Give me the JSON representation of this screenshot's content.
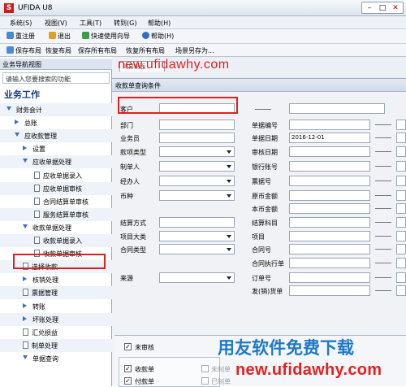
{
  "window": {
    "title": "UFIDA U8",
    "logo": "S"
  },
  "menubar": [
    "系统(S)",
    "视图(V)",
    "工具(T)",
    "转到(G)",
    "帮助(H)"
  ],
  "toolbar1": [
    "重注册",
    "退出",
    "快速使用向导",
    "帮助(H)"
  ],
  "toolbar2": [
    "保存布局",
    "恢复布局",
    "保存所有布局",
    "恢复所有布局",
    "场景另存为..."
  ],
  "sidebar": {
    "header": "业务导航视图",
    "search_placeholder": "请输入您要搜索的功能",
    "title": "业务工作",
    "tree": [
      {
        "label": "财务会计",
        "type": "expanded",
        "level": 0
      },
      {
        "label": "总账",
        "type": "collapsed",
        "level": 1
      },
      {
        "label": "应收款管理",
        "type": "expanded",
        "level": 1
      },
      {
        "label": "设置",
        "type": "collapsed",
        "level": 2
      },
      {
        "label": "应收单据处理",
        "type": "expanded",
        "level": 2
      },
      {
        "label": "应收单据录入",
        "type": "doc",
        "level": 3
      },
      {
        "label": "应收单据审核",
        "type": "doc",
        "level": 3
      },
      {
        "label": "合同结算单审核",
        "type": "doc",
        "level": 3
      },
      {
        "label": "服务结算单审核",
        "type": "doc",
        "level": 3
      },
      {
        "label": "收款单据处理",
        "type": "expanded",
        "level": 2
      },
      {
        "label": "收款单据录入",
        "type": "doc",
        "level": 3
      },
      {
        "label": "收款单据审核",
        "type": "doc",
        "level": 3
      },
      {
        "label": "选择收款",
        "type": "doc",
        "level": 2
      },
      {
        "label": "核销处理",
        "type": "collapsed",
        "level": 2
      },
      {
        "label": "票据管理",
        "type": "doc",
        "level": 2
      },
      {
        "label": "转账",
        "type": "collapsed",
        "level": 2
      },
      {
        "label": "坏账处理",
        "type": "collapsed",
        "level": 2
      },
      {
        "label": "汇兑损益",
        "type": "doc",
        "level": 2
      },
      {
        "label": "制单处理",
        "type": "doc",
        "level": 2
      },
      {
        "label": "单据查询",
        "type": "expanded",
        "level": 2
      }
    ]
  },
  "tabs": {
    "active": "简易桌面"
  },
  "dialog": {
    "title": "收款单查询条件",
    "left_fields": [
      {
        "label": "客户",
        "kind": "input",
        "value": ""
      },
      {
        "label": "部门",
        "kind": "input",
        "value": ""
      },
      {
        "label": "业务员",
        "kind": "input",
        "value": ""
      },
      {
        "label": "款项类型",
        "kind": "select",
        "value": ""
      },
      {
        "label": "制单人",
        "kind": "select",
        "value": ""
      },
      {
        "label": "经办人",
        "kind": "select",
        "value": ""
      },
      {
        "label": "币种",
        "kind": "select",
        "value": ""
      },
      {
        "label": "结算方式",
        "kind": "input",
        "value": ""
      },
      {
        "label": "项目大类",
        "kind": "select",
        "value": ""
      },
      {
        "label": "合同类型",
        "kind": "select",
        "value": ""
      },
      {
        "label": "来源",
        "kind": "select",
        "value": ""
      }
    ],
    "right_fields": [
      {
        "label": "单据编号",
        "kind": "input",
        "value": ""
      },
      {
        "label": "单据日期",
        "kind": "input",
        "value": "2016-12-01"
      },
      {
        "label": "审核日期",
        "kind": "input",
        "value": ""
      },
      {
        "label": "银行账号",
        "kind": "input",
        "value": ""
      },
      {
        "label": "票据号",
        "kind": "input",
        "value": ""
      },
      {
        "label": "原币金额",
        "kind": "input",
        "value": ""
      },
      {
        "label": "本币金额",
        "kind": "input",
        "value": ""
      },
      {
        "label": "结算科目",
        "kind": "input",
        "value": ""
      },
      {
        "label": "项目",
        "kind": "input",
        "value": ""
      },
      {
        "label": "合同号",
        "kind": "input",
        "value": ""
      },
      {
        "label": "合同执行单",
        "kind": "input",
        "value": ""
      },
      {
        "label": "订单号",
        "kind": "input",
        "value": ""
      },
      {
        "label": "发(销)货单",
        "kind": "input",
        "value": ""
      }
    ],
    "unaudited_label": "未审核",
    "unaudited_checked": true,
    "doc_types": [
      {
        "label": "收款单",
        "checked": true
      },
      {
        "label": "付款单",
        "checked": true
      }
    ],
    "right_options": [
      "未制单",
      "已制单"
    ]
  },
  "watermarks": {
    "top": "new.ufidawhy.com",
    "bottom_cn": "用友软件免费下载",
    "bottom_url": "new.ufidawhy.com"
  },
  "colors": {
    "highlight_box": "#e02020",
    "tree_arrow": "#3a6ec5",
    "sidebar_title": "#1e3f7a"
  }
}
